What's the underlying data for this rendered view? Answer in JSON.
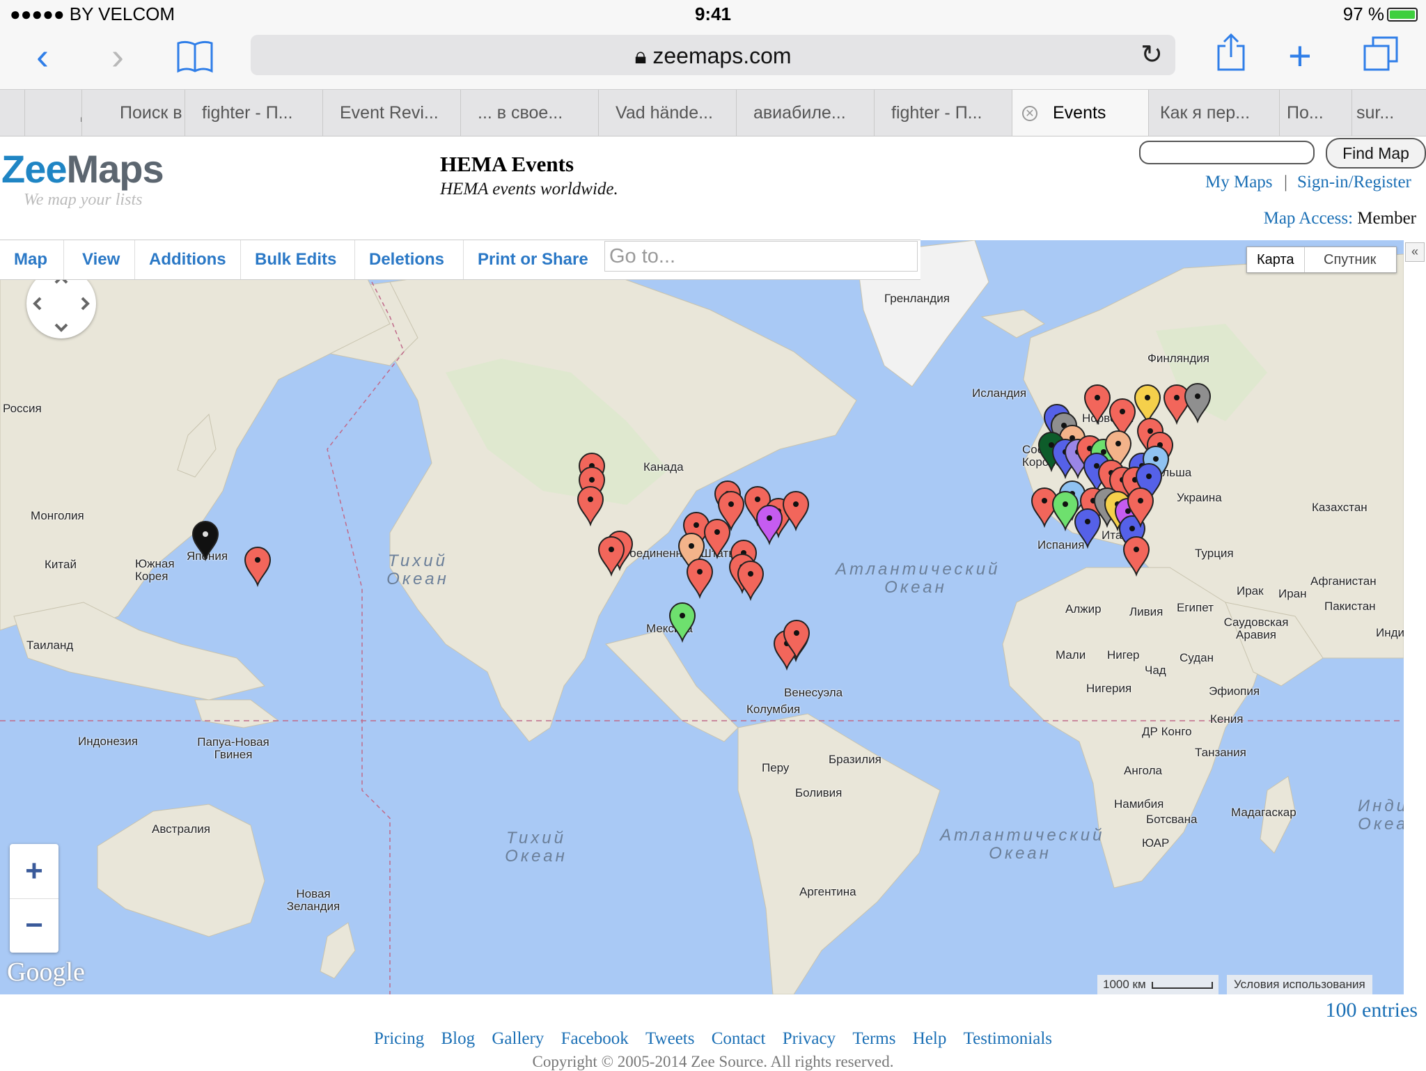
{
  "status": {
    "carrier": "●●●●● BY VELCOM",
    "time": "9:41",
    "battery": "97 %",
    "battery_level": 0.97
  },
  "browser": {
    "url": "zeemaps.com",
    "tabs": [
      "ді",
      "Поиск в",
      "fighter - П...",
      "Event Revi...",
      "... в свое...",
      "Vad hände...",
      "авиабиле...",
      "fighter - П...",
      "Events",
      "Как я пер...",
      "По...",
      "sur..."
    ],
    "active_tab": 8
  },
  "site": {
    "logo_a": "Zee",
    "logo_b": "Maps",
    "tagline": "We map your lists",
    "title": "HEMA Events",
    "subtitle": "HEMA events worldwide.",
    "find_map": "Find Map",
    "find_map_value": "",
    "my_maps": "My Maps",
    "separator": "|",
    "signin": "Sign-in/Register",
    "access_label": "Map Access:",
    "access_value": "Member"
  },
  "menu": [
    "Map",
    "View",
    "Additions",
    "Bulk Edits",
    "Deletions",
    "Print or Share"
  ],
  "goto_placeholder": "Go to...",
  "map": {
    "type_on": "Карта",
    "type_off": "Спутник",
    "collapse": "«",
    "zoom_in": "+",
    "zoom_out": "−",
    "google": "Google",
    "scale": "1000 км",
    "terms": "Условия использования",
    "labels": [
      "Гренландия",
      "Исландия",
      "Финляндия",
      "Россия",
      "Монголия",
      "Китай",
      "Южная Корея",
      "Япония",
      "Таиланд",
      "Индонезия",
      "Папуа-Новая Гвинея",
      "Австралия",
      "Новая Зеландия",
      "Канада",
      "Соединенные Штаты",
      "Мексика",
      "Венесуэла",
      "Колумбия",
      "Перу",
      "Бразилия",
      "Боливия",
      "Аргентина",
      "Украина",
      "Казахстан",
      "Турция",
      "Испания",
      "Италия",
      "Ирак",
      "Иран",
      "Афганистан",
      "Пакистан",
      "Индия",
      "Алжир",
      "Ливия",
      "Египет",
      "Саудовская Аравия",
      "Мали",
      "Нигер",
      "Судан",
      "Чад",
      "Нигерия",
      "Эфиопия",
      "Кения",
      "ДР Конго",
      "Танзания",
      "Ангола",
      "Намибия",
      "Ботсвана",
      "ЮАР",
      "Мадагаскар",
      "Норвегия",
      "Польша",
      "Соединенное Королевство"
    ],
    "oceans": [
      "Тихий Океан",
      "Атлантический Океан",
      "Тихий Океан",
      "Атлантический Океан",
      "Индийский Океан"
    ]
  },
  "entries": "100 entries",
  "footer_links": [
    "Pricing",
    "Blog",
    "Gallery",
    "Facebook",
    "Tweets",
    "Contact",
    "Privacy",
    "Terms",
    "Help",
    "Testimonials"
  ],
  "copyright": "Copyright © 2005-2014 Zee Source. All rights reserved.",
  "colors": {
    "link": "#1a6fb5",
    "menu": "#2a78c6",
    "ocean": "#a9c9f5",
    "land": "#e9e6d9",
    "pin_red": "#f2665b"
  }
}
